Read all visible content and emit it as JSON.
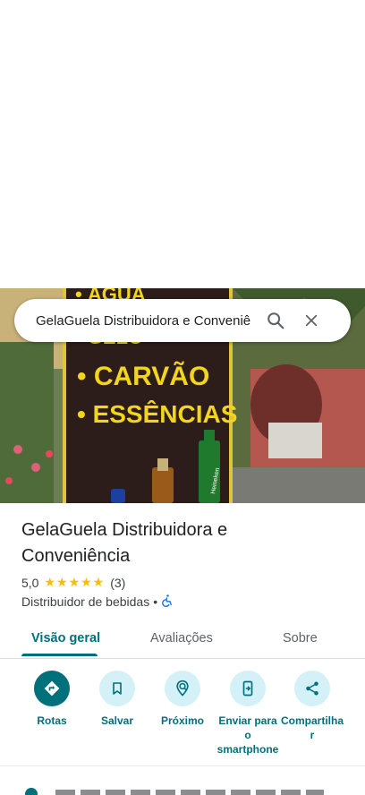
{
  "search": {
    "query": "GelaGuela Distribuidora e Conveniê"
  },
  "photo": {
    "sign_lines": [
      "• CARVÃO",
      "• ESSÊNCIAS"
    ],
    "bottle_label": "Heineken"
  },
  "place": {
    "name": "GelaGuela Distribuidora e Conveniência",
    "rating": "5,0",
    "stars": "★★★★★",
    "review_count": "(3)",
    "category": "Distribuidor de bebidas",
    "separator": "•"
  },
  "tabs": [
    {
      "label": "Visão geral"
    },
    {
      "label": "Avaliações"
    },
    {
      "label": "Sobre"
    }
  ],
  "actions": [
    {
      "label": "Rotas",
      "icon": "directions-icon"
    },
    {
      "label": "Salvar",
      "icon": "bookmark-icon"
    },
    {
      "label": "Próximo",
      "icon": "nearby-icon"
    },
    {
      "label": "Enviar para o smartphone",
      "icon": "send-to-phone-icon"
    },
    {
      "label": "Compartilhar",
      "icon": "share-icon"
    }
  ],
  "colors": {
    "accent": "#00707a",
    "action_bg": "#d3f1f7",
    "star": "#fbbc04"
  }
}
